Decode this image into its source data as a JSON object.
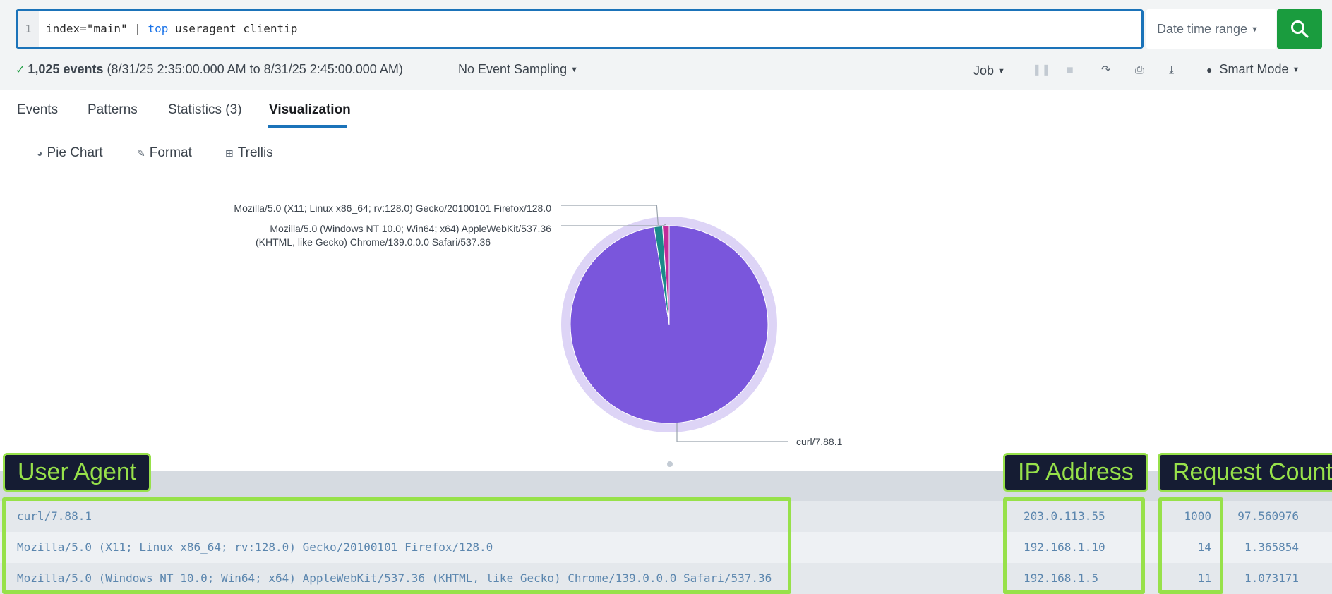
{
  "search": {
    "line_number": "1",
    "query_prefix": "index=\"main\" | ",
    "query_keyword": "top",
    "query_suffix": " useragent clientip",
    "date_range_label": "Date time range",
    "submit_icon": "search-icon"
  },
  "status": {
    "events_count": "1,025 events",
    "events_range": "(8/31/25 2:35:00.000 AM to 8/31/25 2:45:00.000 AM)",
    "sampling_label": "No Event Sampling",
    "job_label": "Job",
    "mode_label": "Smart Mode"
  },
  "tabs": [
    {
      "label": "Events"
    },
    {
      "label": "Patterns"
    },
    {
      "label": "Statistics (3)"
    },
    {
      "label": "Visualization"
    }
  ],
  "viz_toolbar": {
    "chart_type": "Pie Chart",
    "format": "Format",
    "trellis": "Trellis"
  },
  "chart_data": {
    "type": "pie",
    "title": "",
    "slices": [
      {
        "label": "curl/7.88.1",
        "value": 1000,
        "color": "#7a56dc"
      },
      {
        "label": "Mozilla/5.0 (X11; Linux x86_64; rv:128.0) Gecko/20100101 Firefox/128.0",
        "value": 14,
        "color": "#1b8a8a"
      },
      {
        "label": "Mozilla/5.0 (Windows NT 10.0; Win64; x64) AppleWebKit/537.36 (KHTML, like Gecko) Chrome/139.0.0.0 Safari/537.36",
        "value": 11,
        "color": "#c22b9a"
      }
    ],
    "label_lines": {
      "firefox": [
        "Mozilla/5.0 (X11; Linux x86_64; rv:128.0) Gecko/20100101 Firefox/128.0"
      ],
      "chrome": [
        "Mozilla/5.0 (Windows NT 10.0; Win64; x64) AppleWebKit/537.36",
        "(KHTML, like Gecko) Chrome/139.0.0.0 Safari/537.36"
      ],
      "curl": [
        "curl/7.88.1"
      ]
    }
  },
  "annotations": {
    "user_agent": "User Agent",
    "ip_address": "IP Address",
    "request_count": "Request Count"
  },
  "table": {
    "rows": [
      {
        "useragent": "curl/7.88.1",
        "clientip": "203.0.113.55",
        "count": "1000",
        "percent": "97.560976"
      },
      {
        "useragent": "Mozilla/5.0 (X11; Linux x86_64; rv:128.0) Gecko/20100101 Firefox/128.0",
        "clientip": "192.168.1.10",
        "count": "14",
        "percent": "1.365854"
      },
      {
        "useragent": "Mozilla/5.0 (Windows NT 10.0; Win64; x64) AppleWebKit/537.36 (KHTML, like Gecko) Chrome/139.0.0.0 Safari/537.36",
        "clientip": "192.168.1.5",
        "count": "11",
        "percent": "1.073171"
      }
    ]
  }
}
